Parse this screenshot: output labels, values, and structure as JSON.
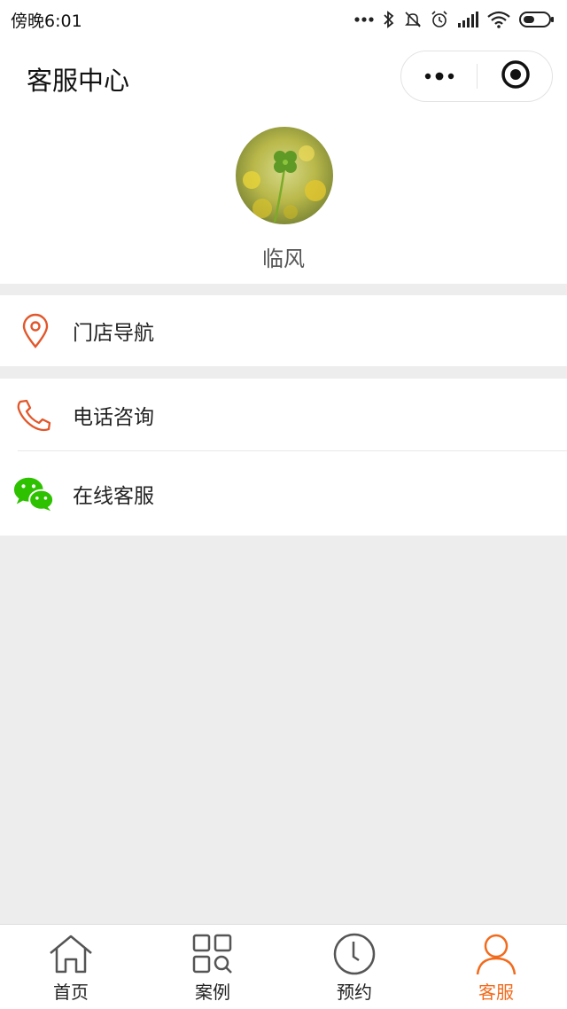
{
  "status_bar": {
    "time": "傍晚6:01",
    "icons": [
      "more-dots-icon",
      "bluetooth-icon",
      "mute-icon",
      "alarm-icon",
      "signal-icon",
      "wifi-icon",
      "battery-icon"
    ]
  },
  "nav": {
    "title": "客服中心",
    "more_icon": "more-dots-icon",
    "close_icon": "target-close-icon"
  },
  "profile": {
    "name": "临风",
    "avatar": "four-leaf-clover-photo"
  },
  "menu": [
    {
      "label": "门店导航",
      "icon": "location-pin-icon"
    },
    {
      "label": "电话咨询",
      "icon": "phone-icon"
    },
    {
      "label": "在线客服",
      "icon": "wechat-icon"
    }
  ],
  "tabs": [
    {
      "label": "首页",
      "icon": "home-icon",
      "active": false
    },
    {
      "label": "案例",
      "icon": "cases-grid-icon",
      "active": false
    },
    {
      "label": "预约",
      "icon": "clock-icon",
      "active": false
    },
    {
      "label": "客服",
      "icon": "user-icon",
      "active": true
    }
  ],
  "colors": {
    "accent": "#f26b1d",
    "wechat_green": "#2dc100",
    "background": "#ededed"
  }
}
